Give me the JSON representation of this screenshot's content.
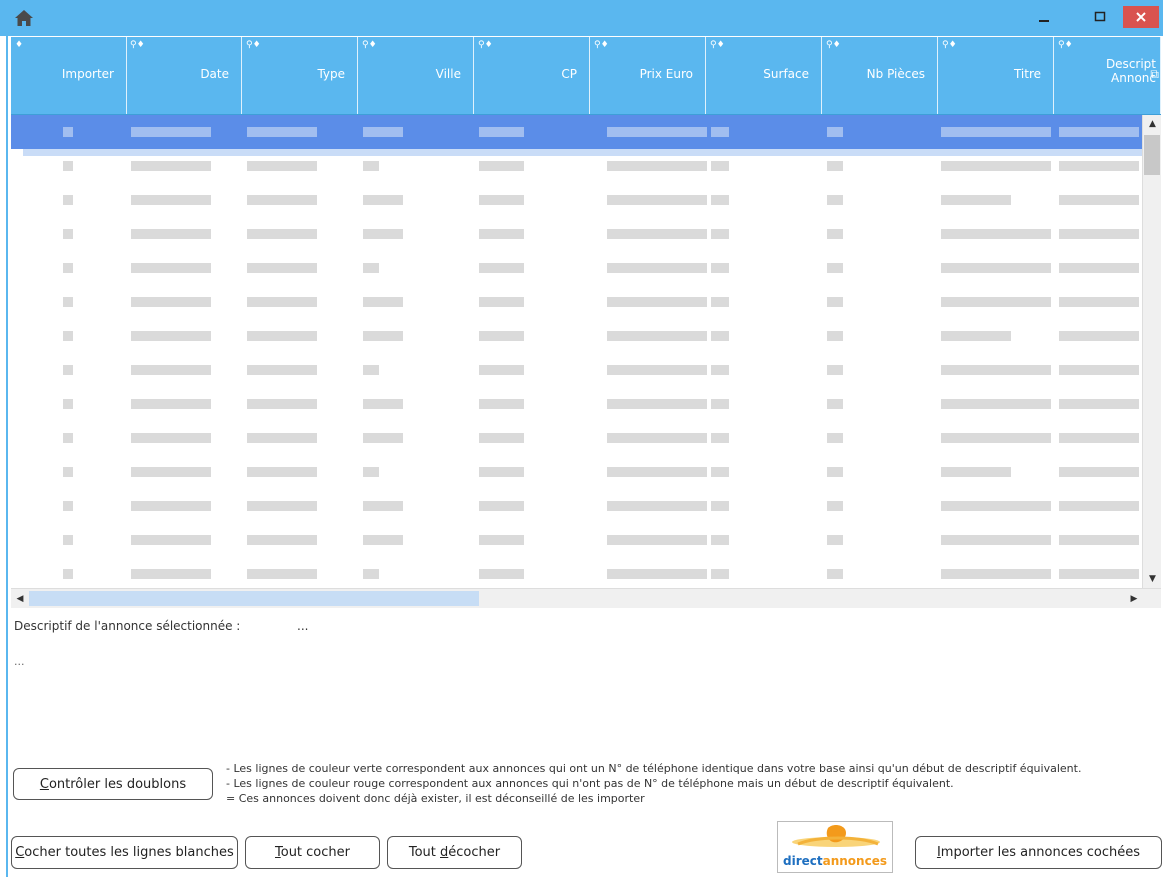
{
  "titlebar": {
    "home_icon": "home-icon",
    "minimize": "–",
    "maximize": "□",
    "close": "×",
    "accent": "#5ab7ef",
    "close_color": "#d9534f"
  },
  "grid": {
    "columns": [
      {
        "label": "Importer",
        "sort_icon": "♦"
      },
      {
        "label": "Date",
        "sort_icon": "⚲♦"
      },
      {
        "label": "Type",
        "sort_icon": "⚲♦"
      },
      {
        "label": "Ville",
        "sort_icon": "⚲♦"
      },
      {
        "label": "CP",
        "sort_icon": "⚲♦"
      },
      {
        "label": "Prix Euro",
        "sort_icon": "⚲♦"
      },
      {
        "label": "Surface",
        "sort_icon": "⚲♦"
      },
      {
        "label": "Nb Pièces",
        "sort_icon": "⚲♦"
      },
      {
        "label": "Titre",
        "sort_icon": "⚲♦"
      },
      {
        "label": "Descript Annonc",
        "sort_icon": "⚲♦"
      }
    ],
    "selected_row_color": "#5b8de8"
  },
  "description": {
    "label": "Descriptif de l'annonce sélectionnée :",
    "value": "...",
    "text": "..."
  },
  "buttons": {
    "controle": {
      "pre": "",
      "u": "C",
      "post": "ontrôler les doublons"
    },
    "cocher_blanches": {
      "pre": "",
      "u": "C",
      "post": "ocher toutes les lignes blanches"
    },
    "tout_cocher": {
      "pre": "",
      "u": "T",
      "post": "out cocher"
    },
    "tout_decocher": {
      "pre": "Tout ",
      "u": "d",
      "post": "écocher"
    },
    "importer": {
      "pre": "",
      "u": "I",
      "post": "mporter les annonces cochées"
    }
  },
  "notes": [
    "- Les lignes de couleur verte correspondent aux annonces qui ont un N° de téléphone identique dans votre base ainsi qu'un début de descriptif équivalent.",
    "- Les lignes de couleur rouge correspondent aux annonces qui n'ont pas de N° de téléphone mais un début de descriptif équivalent.",
    "= Ces annonces doivent donc déjà exister, il est déconseillé de les importer"
  ],
  "logo": {
    "part1": "direct",
    "part2": "annonces"
  }
}
